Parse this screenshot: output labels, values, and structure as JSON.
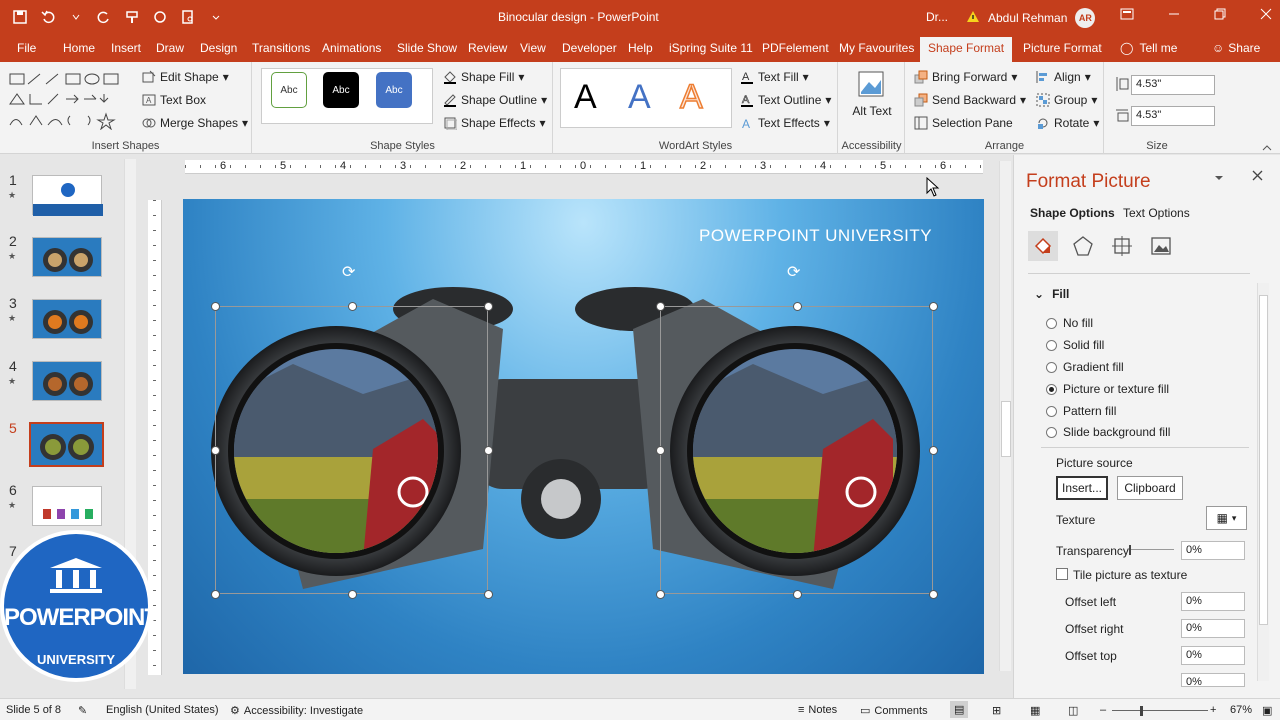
{
  "titlebar": {
    "doc_title": "Binocular design  -  PowerPoint",
    "dr": "Dr...",
    "user_name": "Abdul Rehman",
    "user_initials": "AR"
  },
  "tabs": [
    {
      "label": "File"
    },
    {
      "label": "Home"
    },
    {
      "label": "Insert"
    },
    {
      "label": "Draw"
    },
    {
      "label": "Design"
    },
    {
      "label": "Transitions"
    },
    {
      "label": "Animations"
    },
    {
      "label": "Slide Show"
    },
    {
      "label": "Review"
    },
    {
      "label": "View"
    },
    {
      "label": "Developer"
    },
    {
      "label": "Help"
    },
    {
      "label": "iSpring Suite 11"
    },
    {
      "label": "PDFelement"
    },
    {
      "label": "My Favourites"
    },
    {
      "label": "Shape Format"
    },
    {
      "label": "Picture Format"
    },
    {
      "label": "Tell me"
    },
    {
      "label": "Share"
    }
  ],
  "ribbon": {
    "insert_shapes": {
      "label": "Insert Shapes",
      "edit_shape": "Edit Shape",
      "text_box": "Text Box",
      "merge_shapes": "Merge Shapes"
    },
    "shape_styles": {
      "label": "Shape Styles",
      "style1": "Abc",
      "style2": "Abc",
      "style3": "Abc",
      "shape_fill": "Shape Fill",
      "shape_outline": "Shape Outline",
      "shape_effects": "Shape Effects"
    },
    "wordart": {
      "label": "WordArt Styles",
      "a1": "A",
      "a2": "A",
      "a3": "A",
      "text_fill": "Text Fill",
      "text_outline": "Text Outline",
      "text_effects": "Text Effects"
    },
    "accessibility": {
      "label": "Accessibility",
      "alt_text": "Alt Text"
    },
    "arrange": {
      "label": "Arrange",
      "bring_forward": "Bring Forward",
      "send_backward": "Send Backward",
      "selection_pane": "Selection Pane",
      "align": "Align",
      "group": "Group",
      "rotate": "Rotate"
    },
    "size": {
      "label": "Size",
      "height": "4.53\"",
      "width": "4.53\""
    }
  },
  "slides": [
    {
      "num": "1"
    },
    {
      "num": "2"
    },
    {
      "num": "3"
    },
    {
      "num": "4"
    },
    {
      "num": "5"
    },
    {
      "num": "6"
    },
    {
      "num": "7"
    }
  ],
  "slide": {
    "title": "POWERPOINT UNIVERSITY"
  },
  "logo": {
    "line1": "POWERPOINT",
    "line2": "UNIVERSITY"
  },
  "ruler": {
    "h_ticks": [
      "6",
      "5",
      "4",
      "3",
      "2",
      "1",
      "0",
      "1",
      "2",
      "3",
      "4",
      "5",
      "6"
    ]
  },
  "pane": {
    "title": "Format Picture",
    "tab_shape": "Shape Options",
    "tab_text": "Text Options",
    "section": "Fill",
    "fills": [
      {
        "label": "No fill",
        "on": false
      },
      {
        "label": "Solid fill",
        "on": false
      },
      {
        "label": "Gradient fill",
        "on": false
      },
      {
        "label": "Picture or texture fill",
        "on": true
      },
      {
        "label": "Pattern fill",
        "on": false
      },
      {
        "label": "Slide background fill",
        "on": false
      }
    ],
    "picture_source": "Picture source",
    "insert_btn": "Insert...",
    "clipboard_btn": "Clipboard",
    "texture": "Texture",
    "transparency": "Transparency",
    "transparency_val": "0%",
    "tile": "Tile picture as texture",
    "offset_left": "Offset left",
    "offset_left_val": "0%",
    "offset_right": "Offset right",
    "offset_right_val": "0%",
    "offset_top": "Offset top",
    "offset_top_val": "0%",
    "offset_bottom_val": "0%"
  },
  "status": {
    "slide_of": "Slide 5 of 8",
    "language": "English (United States)",
    "accessibility": "Accessibility: Investigate",
    "notes": "Notes",
    "comments": "Comments",
    "zoom": "67%"
  },
  "colors": {
    "accent": "#c43e1c",
    "pane_title": "#c43e1c"
  }
}
